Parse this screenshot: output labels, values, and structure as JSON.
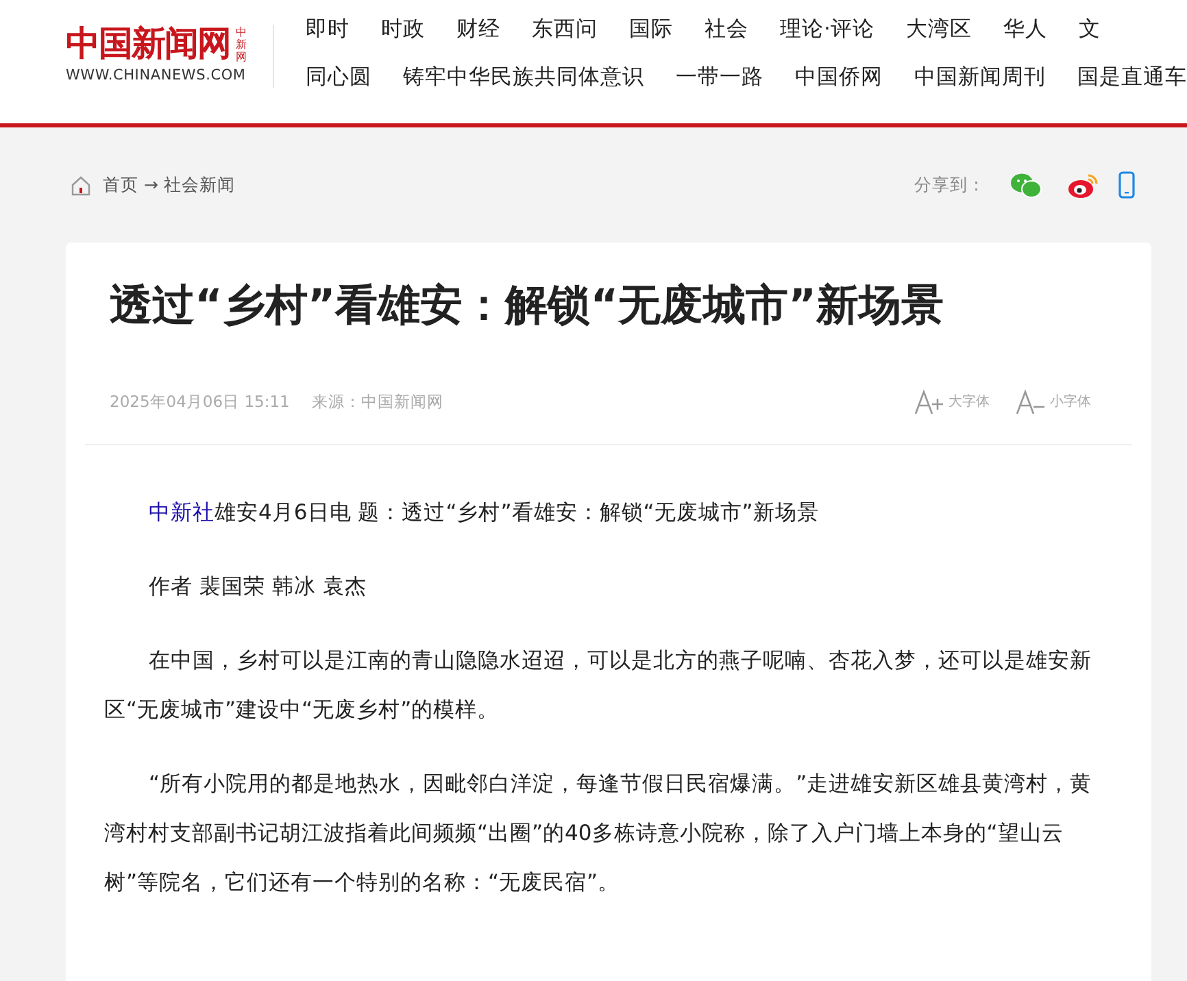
{
  "logo": {
    "name": "中国新闻网",
    "side_mark": "中新网",
    "url": "WWW.CHINANEWS.COM"
  },
  "nav_rows": [
    [
      "即时",
      "时政",
      "财经",
      "东西问",
      "国际",
      "社会",
      "理论·评论",
      "大湾区",
      "华人",
      "文"
    ],
    [
      "同心圆",
      "铸牢中华民族共同体意识",
      "一带一路",
      "中国侨网",
      "中国新闻周刊",
      "国是直通车"
    ]
  ],
  "breadcrumb": {
    "home": "首页",
    "arrow": "→",
    "current": "社会新闻"
  },
  "share": {
    "label": "分享到："
  },
  "article": {
    "title": "透过“乡村”看雄安：解锁“无废城市”新场景",
    "date": "2025年04月06日 15:11",
    "source": "来源：中国新闻网",
    "font_buttons": [
      {
        "kind": "larger",
        "label": "大字体"
      },
      {
        "kind": "smaller",
        "label": "小字体"
      }
    ],
    "paragraphs": [
      {
        "link": "中新社",
        "text": "雄安4月6日电 题：透过“乡村”看雄安：解锁“无废城市”新场景"
      },
      {
        "text": "作者 裴国荣 韩冰 袁杰"
      },
      {
        "text": "在中国，乡村可以是江南的青山隐隐水迢迢，可以是北方的燕子呢喃、杏花入梦，还可以是雄安新区“无废城市”建设中“无废乡村”的模样。"
      },
      {
        "text": "“所有小院用的都是地热水，因毗邻白洋淀，每逢节假日民宿爆满。”走进雄安新区雄县黄湾村，黄湾村村支部副书记胡江波指着此间频频“出圈”的40多栋诗意小院称，除了入户门墙上本身的“望山云树”等院名，它们还有一个特别的名称：“无废民宿”。"
      }
    ]
  }
}
